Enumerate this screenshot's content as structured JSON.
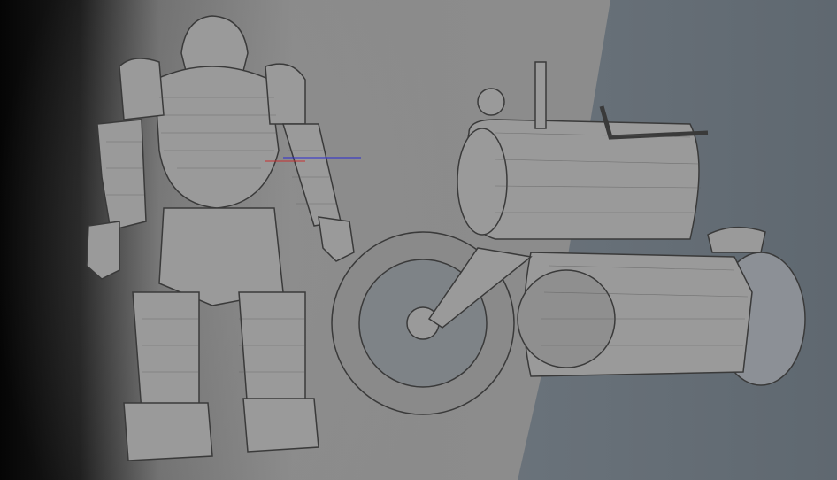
{
  "colors": {
    "background_left": "#050505",
    "background_mid": "#8a8a8a",
    "background_right": "#6b747c",
    "model_fill": "#9a9a9a",
    "model_line": "#3a3a3a"
  },
  "models": [
    "robot-armor-suit",
    "steampunk-motorcycle"
  ]
}
